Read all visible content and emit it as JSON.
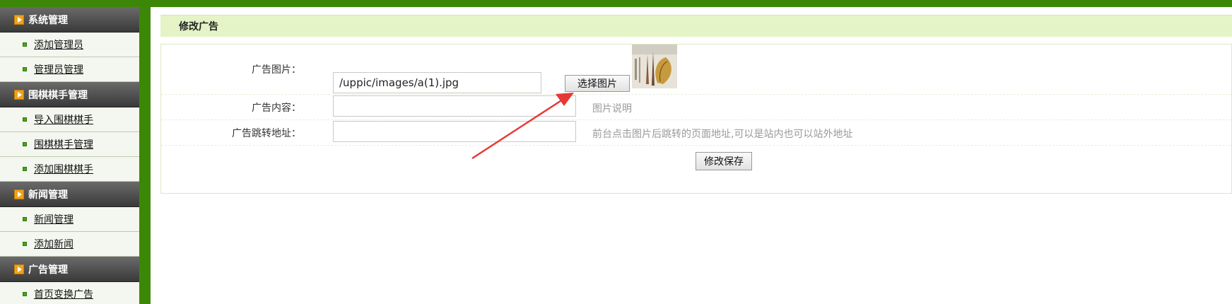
{
  "sidebar": {
    "sections": [
      {
        "title": "系统管理",
        "items": [
          "添加管理员",
          "管理员管理"
        ]
      },
      {
        "title": "围棋棋手管理",
        "items": [
          "导入围棋棋手",
          "围棋棋手管理",
          "添加围棋棋手"
        ]
      },
      {
        "title": "新闻管理",
        "items": [
          "新闻管理",
          "添加新闻"
        ]
      },
      {
        "title": "广告管理",
        "items": [
          "首页变换广告"
        ]
      }
    ]
  },
  "main": {
    "title": "修改广告",
    "form": {
      "image_label": "广告图片：",
      "image_value": "/uppic/images/a(1).jpg",
      "choose_button": "选择图片",
      "content_label": "广告内容：",
      "content_value": "",
      "content_hint": "图片说明",
      "link_label": "广告跳转地址：",
      "link_value": "",
      "link_hint": "前台点击图片后跳转的页面地址,可以是站内也可以站外地址",
      "save_button": "修改保存"
    }
  },
  "colors": {
    "frame_green": "#3d8708",
    "title_bg": "#e4f4c6",
    "annotation_arrow": "#e53935"
  }
}
